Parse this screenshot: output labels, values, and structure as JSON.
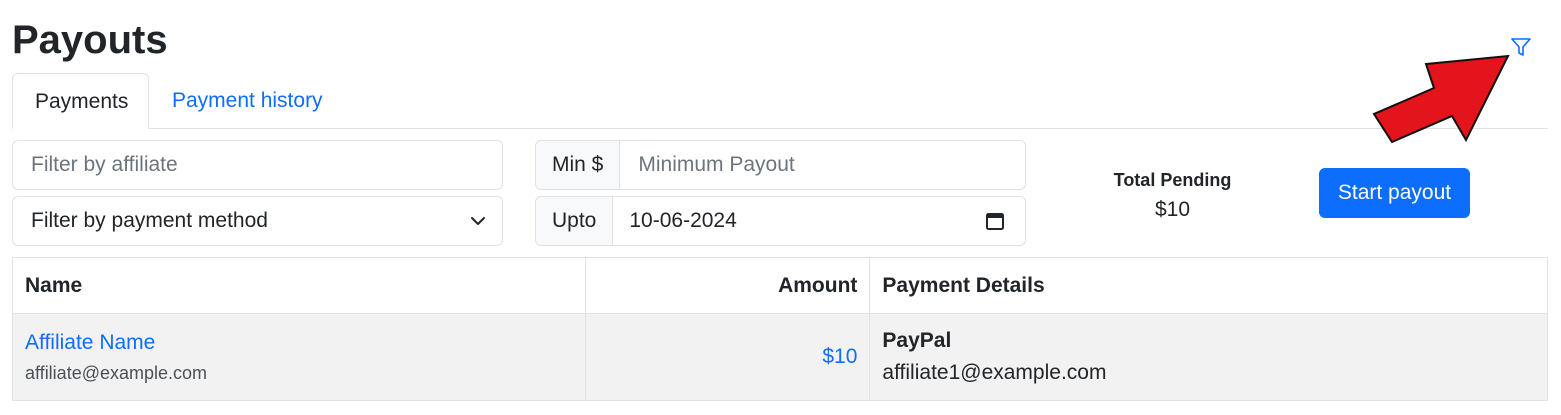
{
  "page": {
    "title": "Payouts"
  },
  "tabs": [
    {
      "label": "Payments",
      "active": true
    },
    {
      "label": "Payment history",
      "active": false
    }
  ],
  "filters": {
    "affiliate_placeholder": "Filter by affiliate",
    "payment_method_selected": "Filter by payment method",
    "min_addon": "Min $",
    "min_placeholder": "Minimum Payout",
    "upto_addon": "Upto",
    "upto_value": "10-06-2024"
  },
  "summary": {
    "pending_label": "Total Pending",
    "pending_value": "$10",
    "start_label": "Start payout"
  },
  "table": {
    "headers": {
      "name": "Name",
      "amount": "Amount",
      "details": "Payment Details"
    },
    "rows": [
      {
        "name": "Affiliate Name",
        "email": "affiliate@example.com",
        "amount": "$10",
        "method": "PayPal",
        "payment_email": "affiliate1@example.com"
      }
    ]
  },
  "icons": {
    "filter": "filter-icon",
    "chevron": "chevron-down-icon",
    "calendar": "calendar-icon",
    "annotation": "red-arrow-annotation"
  },
  "colors": {
    "primary": "#0d6efd",
    "annotation_arrow": "#e3141c",
    "row_bg": "#f2f2f2"
  }
}
